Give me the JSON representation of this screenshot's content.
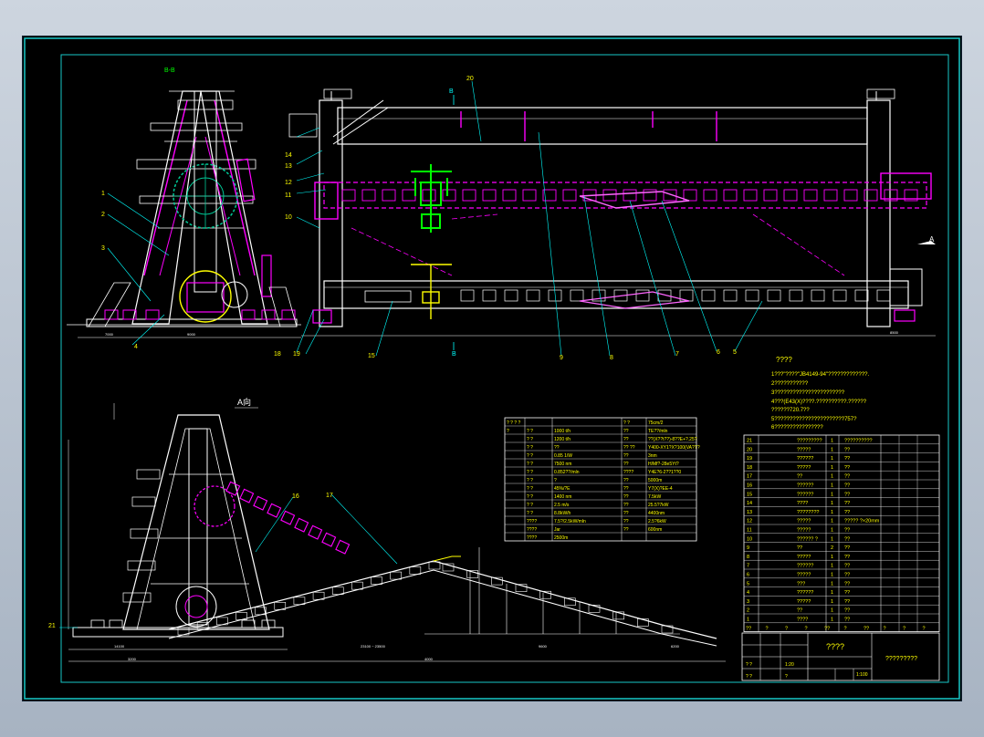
{
  "colors": {
    "background": "#000000",
    "frame": "#18c8c8",
    "structure": "#ffffff",
    "beams": "#ff00ff",
    "hoist": "#00ff00",
    "text": "#ffff00",
    "leaders": "#00ffff"
  },
  "views": {
    "section_label": "B-B",
    "view_label": "A向",
    "arrow_a": "A",
    "arrow_b_top": "B",
    "arrow_b_bottom": "B"
  },
  "callouts": {
    "c1": "1",
    "c2": "2",
    "c3": "3",
    "c4": "4",
    "c5": "5",
    "c6": "6",
    "c7": "7",
    "c8": "8",
    "c9": "9",
    "c10": "10",
    "c11": "11",
    "c12": "12",
    "c13": "13",
    "c14": "14",
    "c15": "15",
    "c16": "16",
    "c17": "17",
    "c18": "18",
    "c19": "19",
    "c20": "20",
    "c21": "21"
  },
  "notes": {
    "title": "????",
    "lines": [
      "1???\"????\"JB4149-94\"?????????????.",
      "2???????????",
      "3???????????????????????",
      "4???(E43(X)????.??????????.??????",
      "    ??????720.7??",
      "5???????????????????????757?",
      "6????????????????"
    ]
  },
  "spec_table": {
    "header": [
      "? ? ? ?",
      "",
      "",
      "? ?",
      "75cm/2"
    ],
    "rows": [
      [
        "?",
        "? ?",
        "1000 t/h",
        "??",
        "TE??/mln"
      ],
      [
        "",
        "? ?",
        "1200 t/h",
        "??",
        "??(X??t??)-8??E+?.25?"
      ],
      [
        "",
        "? ?",
        "??",
        "?? ??",
        "Y400-XY1?X?100(VA?T?"
      ],
      [
        "",
        "? ?",
        "0.85 1/W",
        "??",
        "3nm"
      ],
      [
        "",
        "? ?",
        "7500 nm",
        "??",
        "H/Mf?-28e5Yt?"
      ],
      [
        "",
        "? ?",
        "0.852??/mln",
        "????",
        "Y4E?6-2??1??0"
      ],
      [
        "",
        "? ?",
        "?",
        "??",
        "5000m"
      ],
      [
        "",
        "? ?",
        "45%/?E",
        "??",
        "Y7(X)?EE-4"
      ],
      [
        "",
        "? ?",
        "1400 nm",
        "??",
        "7.5kW"
      ],
      [
        "",
        "? ?",
        "2.5 m/s",
        "??",
        "25.5?7kW"
      ],
      [
        "",
        "? ?",
        "8.8kW/h",
        "??",
        "4400nm"
      ],
      [
        "",
        "????",
        "7.5?/2.5kW/mln",
        "??",
        "2.5?6kW"
      ],
      [
        "",
        "????",
        "Jar",
        "??",
        "600nm"
      ],
      [
        "",
        "????",
        "2500m",
        "",
        ""
      ]
    ]
  },
  "parts_list": {
    "rows": [
      [
        "21",
        "?????????",
        "1",
        "??????????"
      ],
      [
        "20",
        "?????",
        "1",
        "??"
      ],
      [
        "19",
        "??????",
        "1",
        "??"
      ],
      [
        "18",
        "?????",
        "1",
        "??"
      ],
      [
        "17",
        "??",
        "1",
        "??"
      ],
      [
        "16",
        "??????",
        "1",
        "??"
      ],
      [
        "15",
        "??????",
        "1",
        "??"
      ],
      [
        "14",
        "????",
        "1",
        "??"
      ],
      [
        "13",
        "????????",
        "1",
        "??"
      ],
      [
        "12",
        "?????",
        "1",
        "????? ?×20mm"
      ],
      [
        "11",
        "?????",
        "1",
        "??"
      ],
      [
        "10",
        "?????? ?",
        "1",
        "??"
      ],
      [
        "9",
        "??",
        "2",
        "??"
      ],
      [
        "8",
        "?????",
        "1",
        "??"
      ],
      [
        "7",
        "??????",
        "1",
        "??"
      ],
      [
        "6",
        "?????",
        "1",
        "??"
      ],
      [
        "5",
        "???",
        "1",
        "??"
      ],
      [
        "4",
        "??????",
        "1",
        "??"
      ],
      [
        "3",
        "?????",
        "1",
        "??"
      ],
      [
        "2",
        "??",
        "1",
        "??"
      ],
      [
        "1",
        "????",
        "1",
        "??"
      ]
    ],
    "header": [
      "??",
      "?",
      "?",
      "?",
      "??",
      "?",
      "??",
      "?",
      "?",
      "?"
    ]
  },
  "title_block": {
    "title": "????",
    "drawing_name": "?????????",
    "scale": "1:100",
    "sheet_a": "1:20",
    "row1": [
      "? ?",
      "",
      "",
      ""
    ],
    "row2": [
      "? ?",
      "",
      "?",
      ""
    ]
  },
  "dims": {
    "d1": "7000",
    "d2": "9000",
    "d3": "8500",
    "d4": "14100",
    "d5": "23100 ~ 23500",
    "d6": "9600",
    "d7": "6200",
    "d8": "3200",
    "d9": "4000"
  }
}
